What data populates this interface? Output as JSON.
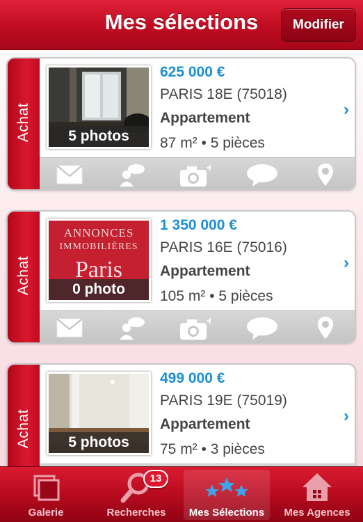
{
  "header": {
    "title": "Mes sélections",
    "modify_label": "Modifier"
  },
  "listings": [
    {
      "transaction": "Achat",
      "photos_label": "5 photos",
      "price": "625 000 €",
      "city": "PARIS 18E (75018)",
      "type": "Appartement",
      "size": "87 m² • 5 pièces"
    },
    {
      "transaction": "Achat",
      "photos_label": "0 photo",
      "price": "1 350 000 €",
      "city": "PARIS 16E (75016)",
      "type": "Appartement",
      "size": "105 m² • 5 pièces",
      "placeholder_logo": {
        "line1": "ANNONCES",
        "line2": "IMMOBILIÈRES",
        "line3": "Paris"
      }
    },
    {
      "transaction": "Achat",
      "photos_label": "5 photos",
      "price": "499 000 €",
      "city": "PARIS 19E (75019)",
      "type": "Appartement",
      "size": "75 m² • 3 pièces"
    }
  ],
  "actions": [
    "mail-icon",
    "contact-icon",
    "add-photo-icon",
    "comment-icon",
    "map-pin-icon"
  ],
  "tabbar": {
    "tabs": [
      {
        "label": "Galerie",
        "icon": "gallery-icon"
      },
      {
        "label": "Recherches",
        "icon": "search-icon",
        "badge": "13"
      },
      {
        "label": "Mes Sélections",
        "icon": "stars-icon",
        "active": true
      },
      {
        "label": "Mes Agences",
        "icon": "agency-icon"
      }
    ]
  },
  "colors": {
    "brand_red": "#c20d23",
    "price_blue": "#1b8fd6"
  }
}
